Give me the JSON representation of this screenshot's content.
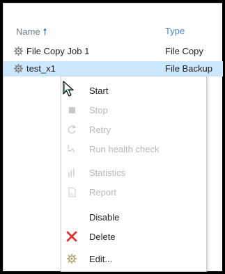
{
  "columns": {
    "name": "Name",
    "type": "Type"
  },
  "rows": [
    {
      "name": "File Copy Job 1",
      "type": "File Copy",
      "selected": false
    },
    {
      "name": "test_x1",
      "type": "File Backup",
      "selected": true
    }
  ],
  "context_menu": {
    "items": [
      {
        "label": "Start",
        "enabled": true,
        "icon": "play-icon"
      },
      {
        "label": "Stop",
        "enabled": false,
        "icon": "stop-icon"
      },
      {
        "label": "Retry",
        "enabled": false,
        "icon": "retry-icon"
      },
      {
        "label": "Run health check",
        "enabled": false,
        "icon": "health-check-icon"
      },
      {
        "label": "Statistics",
        "enabled": false,
        "icon": "statistics-icon"
      },
      {
        "label": "Report",
        "enabled": false,
        "icon": "report-icon"
      },
      {
        "label": "Disable",
        "enabled": true,
        "icon": ""
      },
      {
        "label": "Delete",
        "enabled": true,
        "icon": "delete-icon"
      },
      {
        "label": "Edit...",
        "enabled": true,
        "icon": "edit-gear-icon"
      }
    ]
  },
  "colors": {
    "selection": "#cce8ff",
    "delete": "#e0332b",
    "sort_arrow": "#1f6fd1"
  }
}
